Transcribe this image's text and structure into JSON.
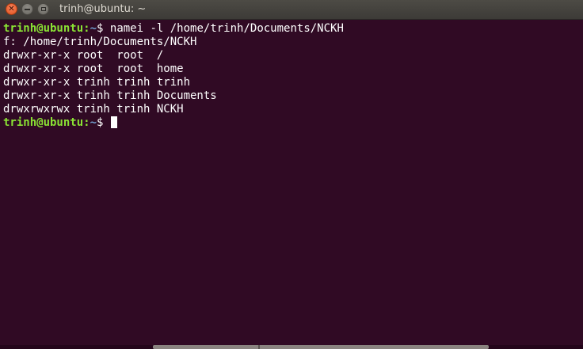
{
  "window": {
    "title": "trinh@ubuntu: ~",
    "close_icon": "close-icon",
    "minimize_icon": "minimize-icon",
    "maximize_icon": "maximize-icon"
  },
  "terminal": {
    "prompt_user": "trinh@ubuntu",
    "prompt_path": "~",
    "prompt_symbol": "$ ",
    "command": "namei -l /home/trinh/Documents/NCKH",
    "output": [
      "f: /home/trinh/Documents/NCKH",
      "drwxr-xr-x root  root  /",
      "drwxr-xr-x root  root  home",
      "drwxr-xr-x trinh trinh trinh",
      "drwxr-xr-x trinh trinh Documents",
      "drwxrwxrwx trinh trinh NCKH"
    ],
    "colors": {
      "background": "#300a24",
      "text": "#ffffff",
      "prompt_user": "#8ae234",
      "prompt_path": "#729fcf"
    }
  }
}
